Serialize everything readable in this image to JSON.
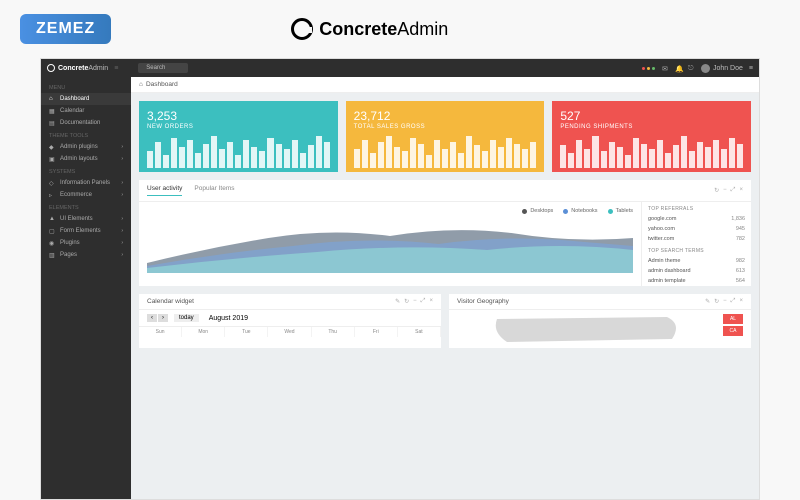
{
  "brands": {
    "zemez": "ZEMEZ",
    "concrete_bold": "Concrete",
    "concrete_light": "Admin"
  },
  "topbar": {
    "logo_bold": "Concrete",
    "logo_light": "Admin",
    "search_placeholder": "Search",
    "user_name": "John Doe"
  },
  "sidebar": {
    "sections": [
      {
        "label": "MENU",
        "items": [
          {
            "label": "Dashboard",
            "icon": "home",
            "active": true
          },
          {
            "label": "Calendar",
            "icon": "calendar"
          },
          {
            "label": "Documentation",
            "icon": "file"
          }
        ]
      },
      {
        "label": "THEME TOOLS",
        "items": [
          {
            "label": "Admin plugins",
            "icon": "plug",
            "chev": true
          },
          {
            "label": "Admin layouts",
            "icon": "layout",
            "chev": true
          }
        ]
      },
      {
        "label": "SYSTEMS",
        "items": [
          {
            "label": "Information Panels",
            "icon": "info",
            "chev": true
          },
          {
            "label": "Ecommerce",
            "icon": "cart",
            "chev": true
          }
        ]
      },
      {
        "label": "ELEMENTS",
        "items": [
          {
            "label": "UI Elements",
            "icon": "ui",
            "chev": true
          },
          {
            "label": "Form Elements",
            "icon": "form",
            "chev": true
          },
          {
            "label": "Plugins",
            "icon": "plugin",
            "chev": true
          },
          {
            "label": "Pages",
            "icon": "pages",
            "chev": true
          }
        ]
      }
    ]
  },
  "breadcrumb": {
    "home": "⌂",
    "current": "Dashboard"
  },
  "stats": [
    {
      "value": "3,253",
      "label": "NEW ORDERS",
      "color": "teal"
    },
    {
      "value": "23,712",
      "label": "TOTAL SALES GROSS",
      "color": "yellow"
    },
    {
      "value": "527",
      "label": "PENDING SHIPMENTS",
      "color": "red"
    }
  ],
  "activity": {
    "tabs": [
      {
        "label": "User activity",
        "active": true
      },
      {
        "label": "Popular Items"
      }
    ],
    "legend": [
      {
        "label": "Desktops",
        "color": "#555"
      },
      {
        "label": "Notebooks",
        "color": "#5b8fd6"
      },
      {
        "label": "Tablets",
        "color": "#3cbfbf"
      }
    ],
    "referrals": {
      "title": "TOP REFERRALS",
      "rows": [
        {
          "name": "google.com",
          "value": "1,836"
        },
        {
          "name": "yahoo.com",
          "value": "945"
        },
        {
          "name": "twitter.com",
          "value": "782"
        }
      ]
    },
    "search": {
      "title": "TOP SEARCH TERMS",
      "rows": [
        {
          "name": "Admin theme",
          "value": "982"
        },
        {
          "name": "admin dashboard",
          "value": "613"
        },
        {
          "name": "admin template",
          "value": "564"
        }
      ]
    }
  },
  "calendar": {
    "title": "Calendar widget",
    "month": "August 2019",
    "today": "today",
    "days": [
      "Sun",
      "Mon",
      "Tue",
      "Wed",
      "Thu",
      "Fri",
      "Sat"
    ]
  },
  "geography": {
    "title": "Visitor Geography",
    "states": [
      "AL",
      "CA"
    ]
  },
  "chart_data": [
    {
      "type": "bar",
      "title": "NEW ORDERS",
      "values": [
        18,
        28,
        14,
        32,
        22,
        30,
        16,
        26,
        34,
        20,
        28,
        14,
        30,
        22,
        18,
        32,
        26,
        20,
        30,
        16,
        24,
        34,
        28
      ]
    },
    {
      "type": "bar",
      "title": "TOTAL SALES GROSS",
      "values": [
        20,
        30,
        16,
        28,
        34,
        22,
        18,
        32,
        26,
        14,
        30,
        20,
        28,
        16,
        34,
        24,
        18,
        30,
        22,
        32,
        26,
        20,
        28
      ]
    },
    {
      "type": "bar",
      "title": "PENDING SHIPMENTS",
      "values": [
        24,
        16,
        30,
        20,
        34,
        18,
        28,
        22,
        14,
        32,
        26,
        20,
        30,
        16,
        24,
        34,
        18,
        28,
        22,
        30,
        20,
        32,
        26
      ]
    },
    {
      "type": "area",
      "title": "User activity",
      "series": [
        {
          "name": "Desktops",
          "values": [
            10,
            18,
            28,
            40,
            52,
            45,
            35,
            42,
            55,
            48,
            38,
            25
          ]
        },
        {
          "name": "Notebooks",
          "values": [
            8,
            14,
            22,
            32,
            42,
            38,
            30,
            36,
            46,
            40,
            32,
            20
          ]
        },
        {
          "name": "Tablets",
          "values": [
            5,
            10,
            16,
            24,
            32,
            28,
            22,
            28,
            36,
            30,
            24,
            15
          ]
        }
      ],
      "x": [
        1,
        2,
        3,
        4,
        5,
        6,
        7,
        8,
        9,
        10,
        11,
        12
      ],
      "ylim": [
        0,
        60
      ]
    }
  ]
}
